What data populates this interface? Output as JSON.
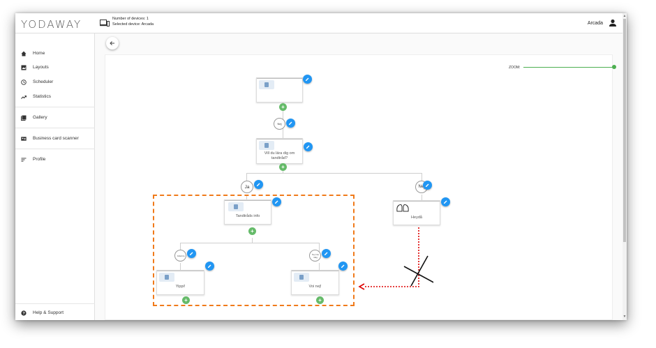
{
  "app": {
    "logo": "YODAWAY"
  },
  "header": {
    "devices_label": "Number of devices: 1",
    "selected_label": "Selected device: Arcada",
    "user_name": "Arcada"
  },
  "sidebar": {
    "items": [
      {
        "label": "Home"
      },
      {
        "label": "Layouts"
      },
      {
        "label": "Scheduler"
      },
      {
        "label": "Statistics"
      },
      {
        "label": "Gallery"
      },
      {
        "label": "Business card scanner"
      },
      {
        "label": "Profile"
      }
    ],
    "help_label": "Help & Support"
  },
  "canvas": {
    "zoom_label": "ZOOM:"
  },
  "flow": {
    "choice_nej_small": "Nej",
    "card_question": "Vill du lära dig om tandtråd?",
    "choice_ja": "Ja",
    "choice_nej": "Nej",
    "card_tandtrads": "Tandtråds info",
    "card_heyda": "Heydå",
    "choice_left_small": "Jättebra",
    "choice_right_small": "Nej inte idag",
    "card_yippi": "Yippi!",
    "card_voi": "Voi nej!"
  },
  "colors": {
    "edit": "#2196f3",
    "add": "#66bb6a",
    "selection": "#f07a1a",
    "annotation_arrow": "#dd0000",
    "zoom": "#4caf50"
  }
}
